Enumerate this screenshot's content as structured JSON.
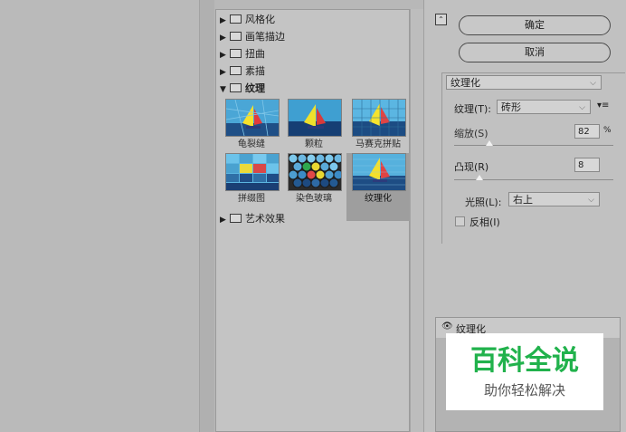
{
  "gallery": {
    "categories_top": [
      {
        "label": "风格化",
        "expanded": false
      },
      {
        "label": "画笔描边",
        "expanded": false
      },
      {
        "label": "扭曲",
        "expanded": false
      },
      {
        "label": "素描",
        "expanded": false
      },
      {
        "label": "纹理",
        "expanded": true
      }
    ],
    "thumbnails": [
      {
        "label": "龟裂缝"
      },
      {
        "label": "颗粒"
      },
      {
        "label": "马赛克拼贴"
      },
      {
        "label": "拼缀图"
      },
      {
        "label": "染色玻璃"
      },
      {
        "label": "纹理化",
        "selected": true
      }
    ],
    "category_bottom": {
      "label": "艺术效果",
      "expanded": false
    }
  },
  "buttons": {
    "ok": "确定",
    "cancel": "取消"
  },
  "filter_select": "纹理化",
  "params": {
    "texture_label": "纹理(T):",
    "texture_value": "砖形",
    "scale_label": "缩放(S)",
    "scale_value": "82",
    "scale_unit": "%",
    "scale_fraction": 0.22,
    "relief_label": "凸现(R)",
    "relief_value": "8",
    "relief_fraction": 0.16,
    "light_label": "光照(L):",
    "light_value": "右上",
    "invert_label": "反相(I)"
  },
  "layers": {
    "effect_name": "纹理化"
  },
  "watermark": {
    "title": "百科全说",
    "subtitle": "助你轻松解决"
  },
  "colors": {
    "watermark_green": "#21b24c",
    "selected_bg": "#9e9e9e"
  },
  "icons": {
    "collapse": "collapse-icon",
    "eye": "eye-icon",
    "menu": "menu-icon"
  }
}
